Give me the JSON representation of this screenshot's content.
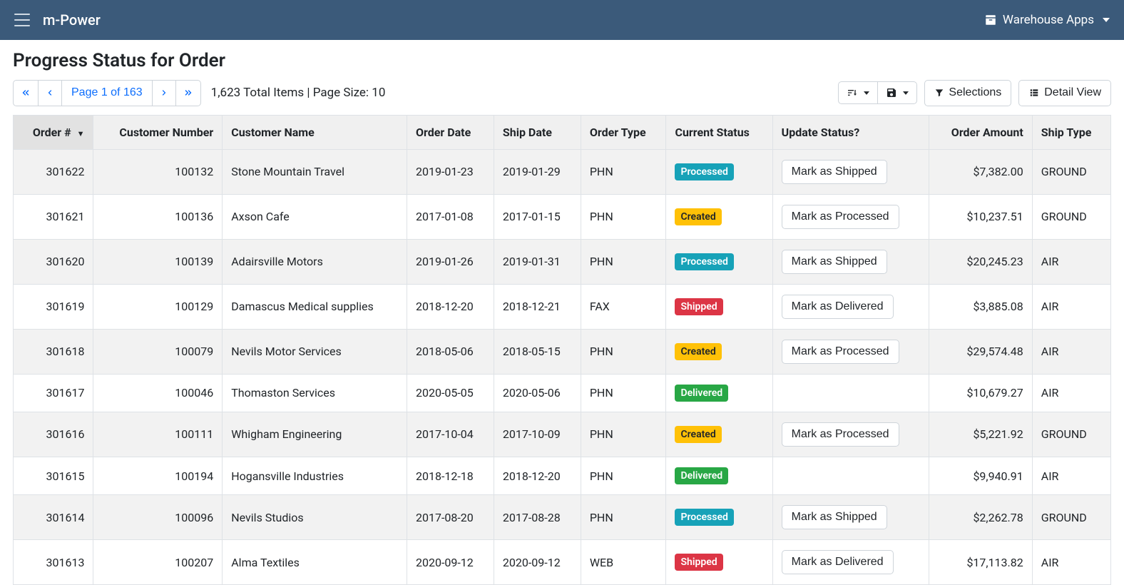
{
  "header": {
    "brand": "m-Power",
    "right_menu": "Warehouse Apps"
  },
  "page": {
    "title": "Progress Status for Order",
    "page_label": "Page 1 of 163",
    "summary": "1,623 Total Items | Page Size: 10",
    "selections_label": "Selections",
    "detail_view_label": "Detail View"
  },
  "columns": [
    "Order #",
    "Customer Number",
    "Customer Name",
    "Order Date",
    "Ship Date",
    "Order Type",
    "Current Status",
    "Update Status?",
    "Order Amount",
    "Ship Type"
  ],
  "status_styles": {
    "Processed": "teal",
    "Created": "yellow",
    "Shipped": "red",
    "Delivered": "green"
  },
  "rows": [
    {
      "order": "301622",
      "cust_no": "100132",
      "cust_name": "Stone Mountain Travel",
      "order_date": "2019-01-23",
      "ship_date": "2019-01-29",
      "order_type": "PHN",
      "status": "Processed",
      "action": "Mark as Shipped",
      "amount": "$7,382.00",
      "ship_type": "GROUND"
    },
    {
      "order": "301621",
      "cust_no": "100136",
      "cust_name": "Axson Cafe",
      "order_date": "2017-01-08",
      "ship_date": "2017-01-15",
      "order_type": "PHN",
      "status": "Created",
      "action": "Mark as Processed",
      "amount": "$10,237.51",
      "ship_type": "GROUND"
    },
    {
      "order": "301620",
      "cust_no": "100139",
      "cust_name": "Adairsville Motors",
      "order_date": "2019-01-26",
      "ship_date": "2019-01-31",
      "order_type": "PHN",
      "status": "Processed",
      "action": "Mark as Shipped",
      "amount": "$20,245.23",
      "ship_type": "AIR"
    },
    {
      "order": "301619",
      "cust_no": "100129",
      "cust_name": "Damascus Medical supplies",
      "order_date": "2018-12-20",
      "ship_date": "2018-12-21",
      "order_type": "FAX",
      "status": "Shipped",
      "action": "Mark as Delivered",
      "amount": "$3,885.08",
      "ship_type": "AIR"
    },
    {
      "order": "301618",
      "cust_no": "100079",
      "cust_name": "Nevils Motor Services",
      "order_date": "2018-05-06",
      "ship_date": "2018-05-15",
      "order_type": "PHN",
      "status": "Created",
      "action": "Mark as Processed",
      "amount": "$29,574.48",
      "ship_type": "AIR"
    },
    {
      "order": "301617",
      "cust_no": "100046",
      "cust_name": "Thomaston Services",
      "order_date": "2020-05-05",
      "ship_date": "2020-05-06",
      "order_type": "PHN",
      "status": "Delivered",
      "action": "",
      "amount": "$10,679.27",
      "ship_type": "AIR"
    },
    {
      "order": "301616",
      "cust_no": "100111",
      "cust_name": "Whigham Engineering",
      "order_date": "2017-10-04",
      "ship_date": "2017-10-09",
      "order_type": "PHN",
      "status": "Created",
      "action": "Mark as Processed",
      "amount": "$5,221.92",
      "ship_type": "GROUND"
    },
    {
      "order": "301615",
      "cust_no": "100194",
      "cust_name": "Hogansville Industries",
      "order_date": "2018-12-18",
      "ship_date": "2018-12-20",
      "order_type": "PHN",
      "status": "Delivered",
      "action": "",
      "amount": "$9,940.91",
      "ship_type": "AIR"
    },
    {
      "order": "301614",
      "cust_no": "100096",
      "cust_name": "Nevils Studios",
      "order_date": "2017-08-20",
      "ship_date": "2017-08-28",
      "order_type": "PHN",
      "status": "Processed",
      "action": "Mark as Shipped",
      "amount": "$2,262.78",
      "ship_type": "GROUND"
    },
    {
      "order": "301613",
      "cust_no": "100207",
      "cust_name": "Alma Textiles",
      "order_date": "2020-09-12",
      "ship_date": "2020-09-12",
      "order_type": "WEB",
      "status": "Shipped",
      "action": "Mark as Delivered",
      "amount": "$17,113.82",
      "ship_type": "AIR"
    }
  ]
}
